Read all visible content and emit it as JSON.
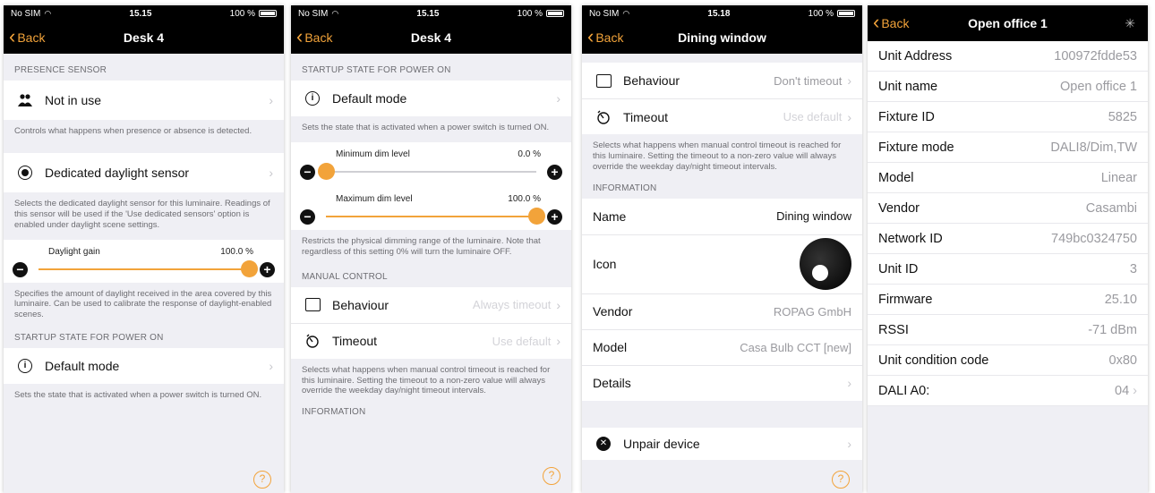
{
  "screen1": {
    "status": {
      "carrier": "No SIM",
      "time": "15.15",
      "battery": "100 %"
    },
    "nav": {
      "back": "Back",
      "title": "Desk 4"
    },
    "presence_header": "PRESENCE SENSOR",
    "not_in_use": "Not in use",
    "presence_footer": "Controls what happens when presence or absence is detected.",
    "daylight_sensor": "Dedicated daylight sensor",
    "daylight_footer": "Selects the dedicated daylight sensor for this luminaire. Readings of this sensor will be used if the 'Use dedicated sensors' option is enabled under daylight scene settings.",
    "gain_label": "Daylight gain",
    "gain_value": "100.0 %",
    "gain_level": 1.0,
    "gain_footer": "Specifies the amount of daylight received in the area covered by this luminaire. Can be used to calibrate the response of daylight-enabled scenes.",
    "startup_header": "STARTUP STATE FOR POWER ON",
    "default_mode": "Default mode",
    "startup_footer": "Sets the state that is activated when a power switch is turned ON.",
    "help": "?"
  },
  "screen2": {
    "status": {
      "carrier": "No SIM",
      "time": "15.15",
      "battery": "100 %"
    },
    "nav": {
      "back": "Back",
      "title": "Desk 4"
    },
    "startup_header": "STARTUP STATE FOR POWER ON",
    "default_mode": "Default mode",
    "startup_footer": "Sets the state that is activated when a power switch is turned ON.",
    "min_label": "Minimum dim level",
    "min_value": "0.0 %",
    "min_level": 0.0,
    "max_label": "Maximum dim level",
    "max_value": "100.0 %",
    "max_level": 1.0,
    "dim_footer": "Restricts the physical dimming range of the luminaire. Note that regardless of this setting 0% will turn the luminaire OFF.",
    "manual_header": "MANUAL CONTROL",
    "behaviour": "Behaviour",
    "behaviour_value": "Always timeout",
    "timeout": "Timeout",
    "timeout_value": "Use default",
    "manual_footer": "Selects what happens when manual control timeout is reached for this luminaire. Setting the timeout to a non-zero value will always override the weekday day/night timeout intervals.",
    "info_header": "INFORMATION",
    "help": "?"
  },
  "screen3": {
    "status": {
      "carrier": "No SIM",
      "time": "15.18",
      "battery": "100 %"
    },
    "nav": {
      "back": "Back",
      "title": "Dining window"
    },
    "behaviour": "Behaviour",
    "behaviour_value": "Don't timeout",
    "timeout": "Timeout",
    "timeout_value": "Use default",
    "manual_footer": "Selects what happens when manual control timeout is reached for this luminaire. Setting the timeout to a non-zero value will always override the weekday day/night timeout intervals.",
    "info_header": "INFORMATION",
    "name_label": "Name",
    "name_value": "Dining window",
    "icon_label": "Icon",
    "vendor_label": "Vendor",
    "vendor_value": "ROPAG GmbH",
    "model_label": "Model",
    "model_value": "Casa Bulb CCT [new]",
    "details_label": "Details",
    "unpair_label": "Unpair device",
    "help": "?"
  },
  "screen4": {
    "nav": {
      "back": "Back",
      "title": "Open office 1"
    },
    "rows": [
      {
        "k": "Unit Address",
        "v": "100972fdde53"
      },
      {
        "k": "Unit name",
        "v": "Open office 1"
      },
      {
        "k": "Fixture ID",
        "v": "5825"
      },
      {
        "k": "Fixture mode",
        "v": "DALI8/Dim,TW"
      },
      {
        "k": "Model",
        "v": "Linear"
      },
      {
        "k": "Vendor",
        "v": "Casambi"
      },
      {
        "k": "Network ID",
        "v": "749bc0324750"
      },
      {
        "k": "Unit ID",
        "v": "3"
      },
      {
        "k": "Firmware",
        "v": "25.10"
      },
      {
        "k": "RSSI",
        "v": "-71 dBm"
      },
      {
        "k": "Unit condition code",
        "v": "0x80"
      },
      {
        "k": "DALI A0:",
        "v": "04"
      }
    ]
  },
  "colors": {
    "accent": "#f2a33a",
    "bar": "#000000",
    "group_bg": "#efeff4"
  }
}
